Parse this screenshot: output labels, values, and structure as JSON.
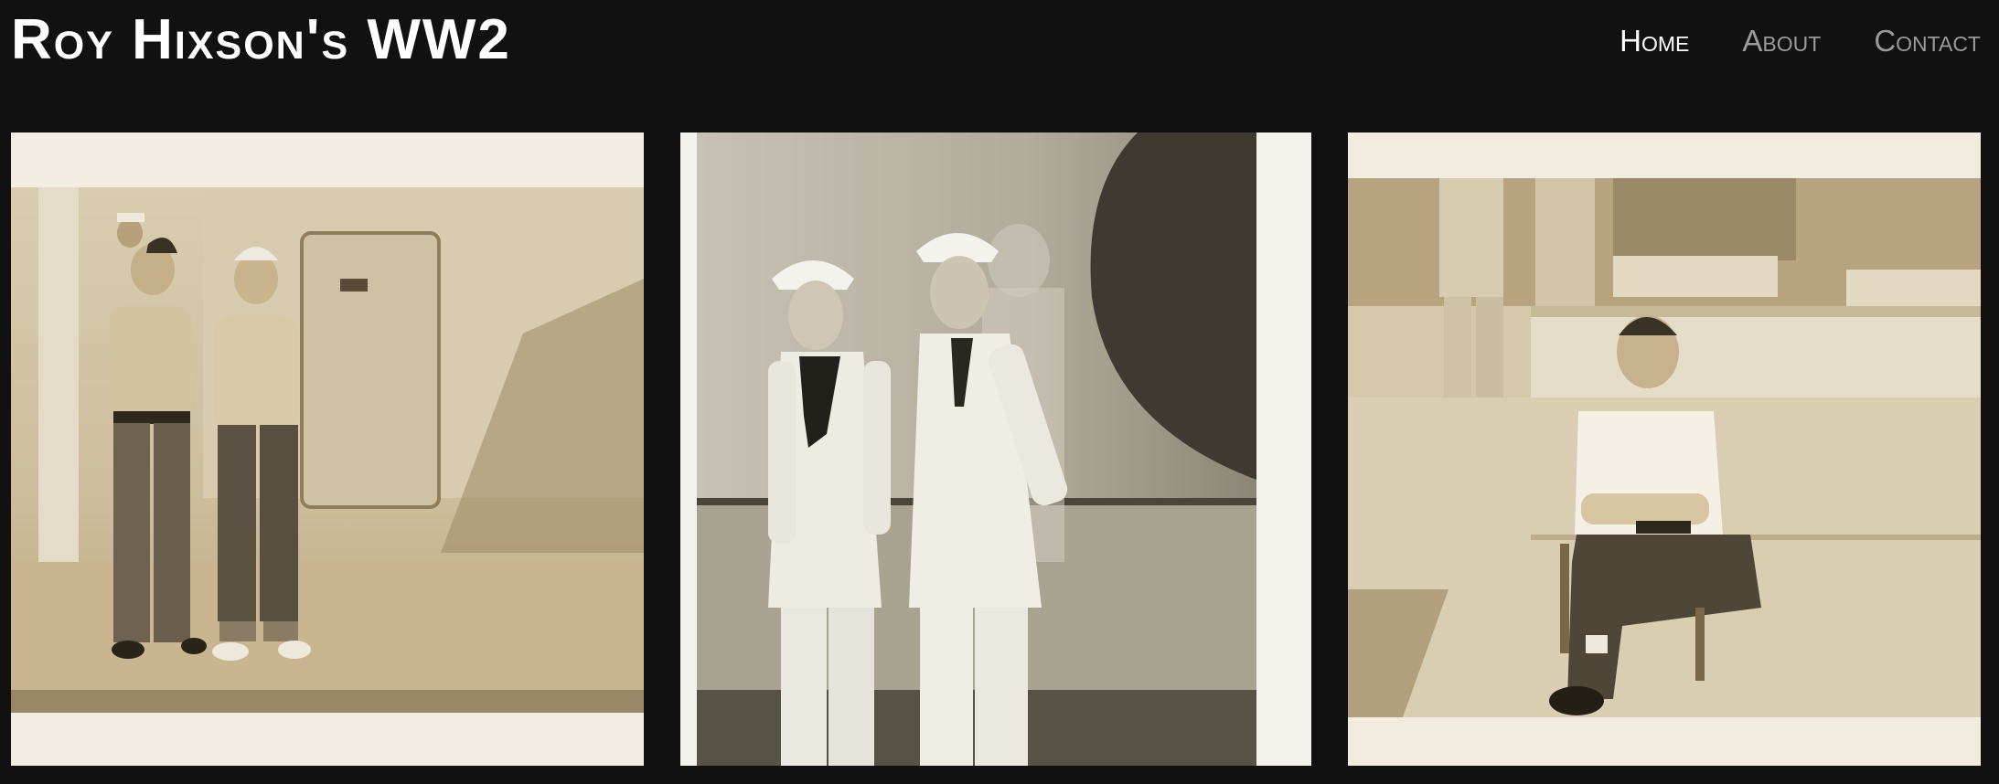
{
  "site": {
    "title": "Roy Hixson's WW2"
  },
  "nav": {
    "items": [
      {
        "label": "Home",
        "active": true
      },
      {
        "label": "About",
        "active": false
      },
      {
        "label": "Contact",
        "active": false
      }
    ]
  },
  "colors": {
    "background": "#111111",
    "title": "#ffffff",
    "nav_active": "#ffffff",
    "nav_inactive": "#9a9a9a",
    "photo_border": "#f1ece1",
    "sepia_dark": "#3a3124",
    "sepia_mid": "#a8997c",
    "sepia_light": "#e6dcc6"
  },
  "gallery": {
    "photos": [
      {
        "subject": "two shirtless sailors standing on ship deck",
        "icon": "photo-icon"
      },
      {
        "subject": "two sailors in white uniforms with neckerchiefs",
        "icon": "photo-icon"
      },
      {
        "subject": "sailor in white t-shirt sitting on a chair on deck",
        "icon": "photo-icon"
      }
    ]
  }
}
